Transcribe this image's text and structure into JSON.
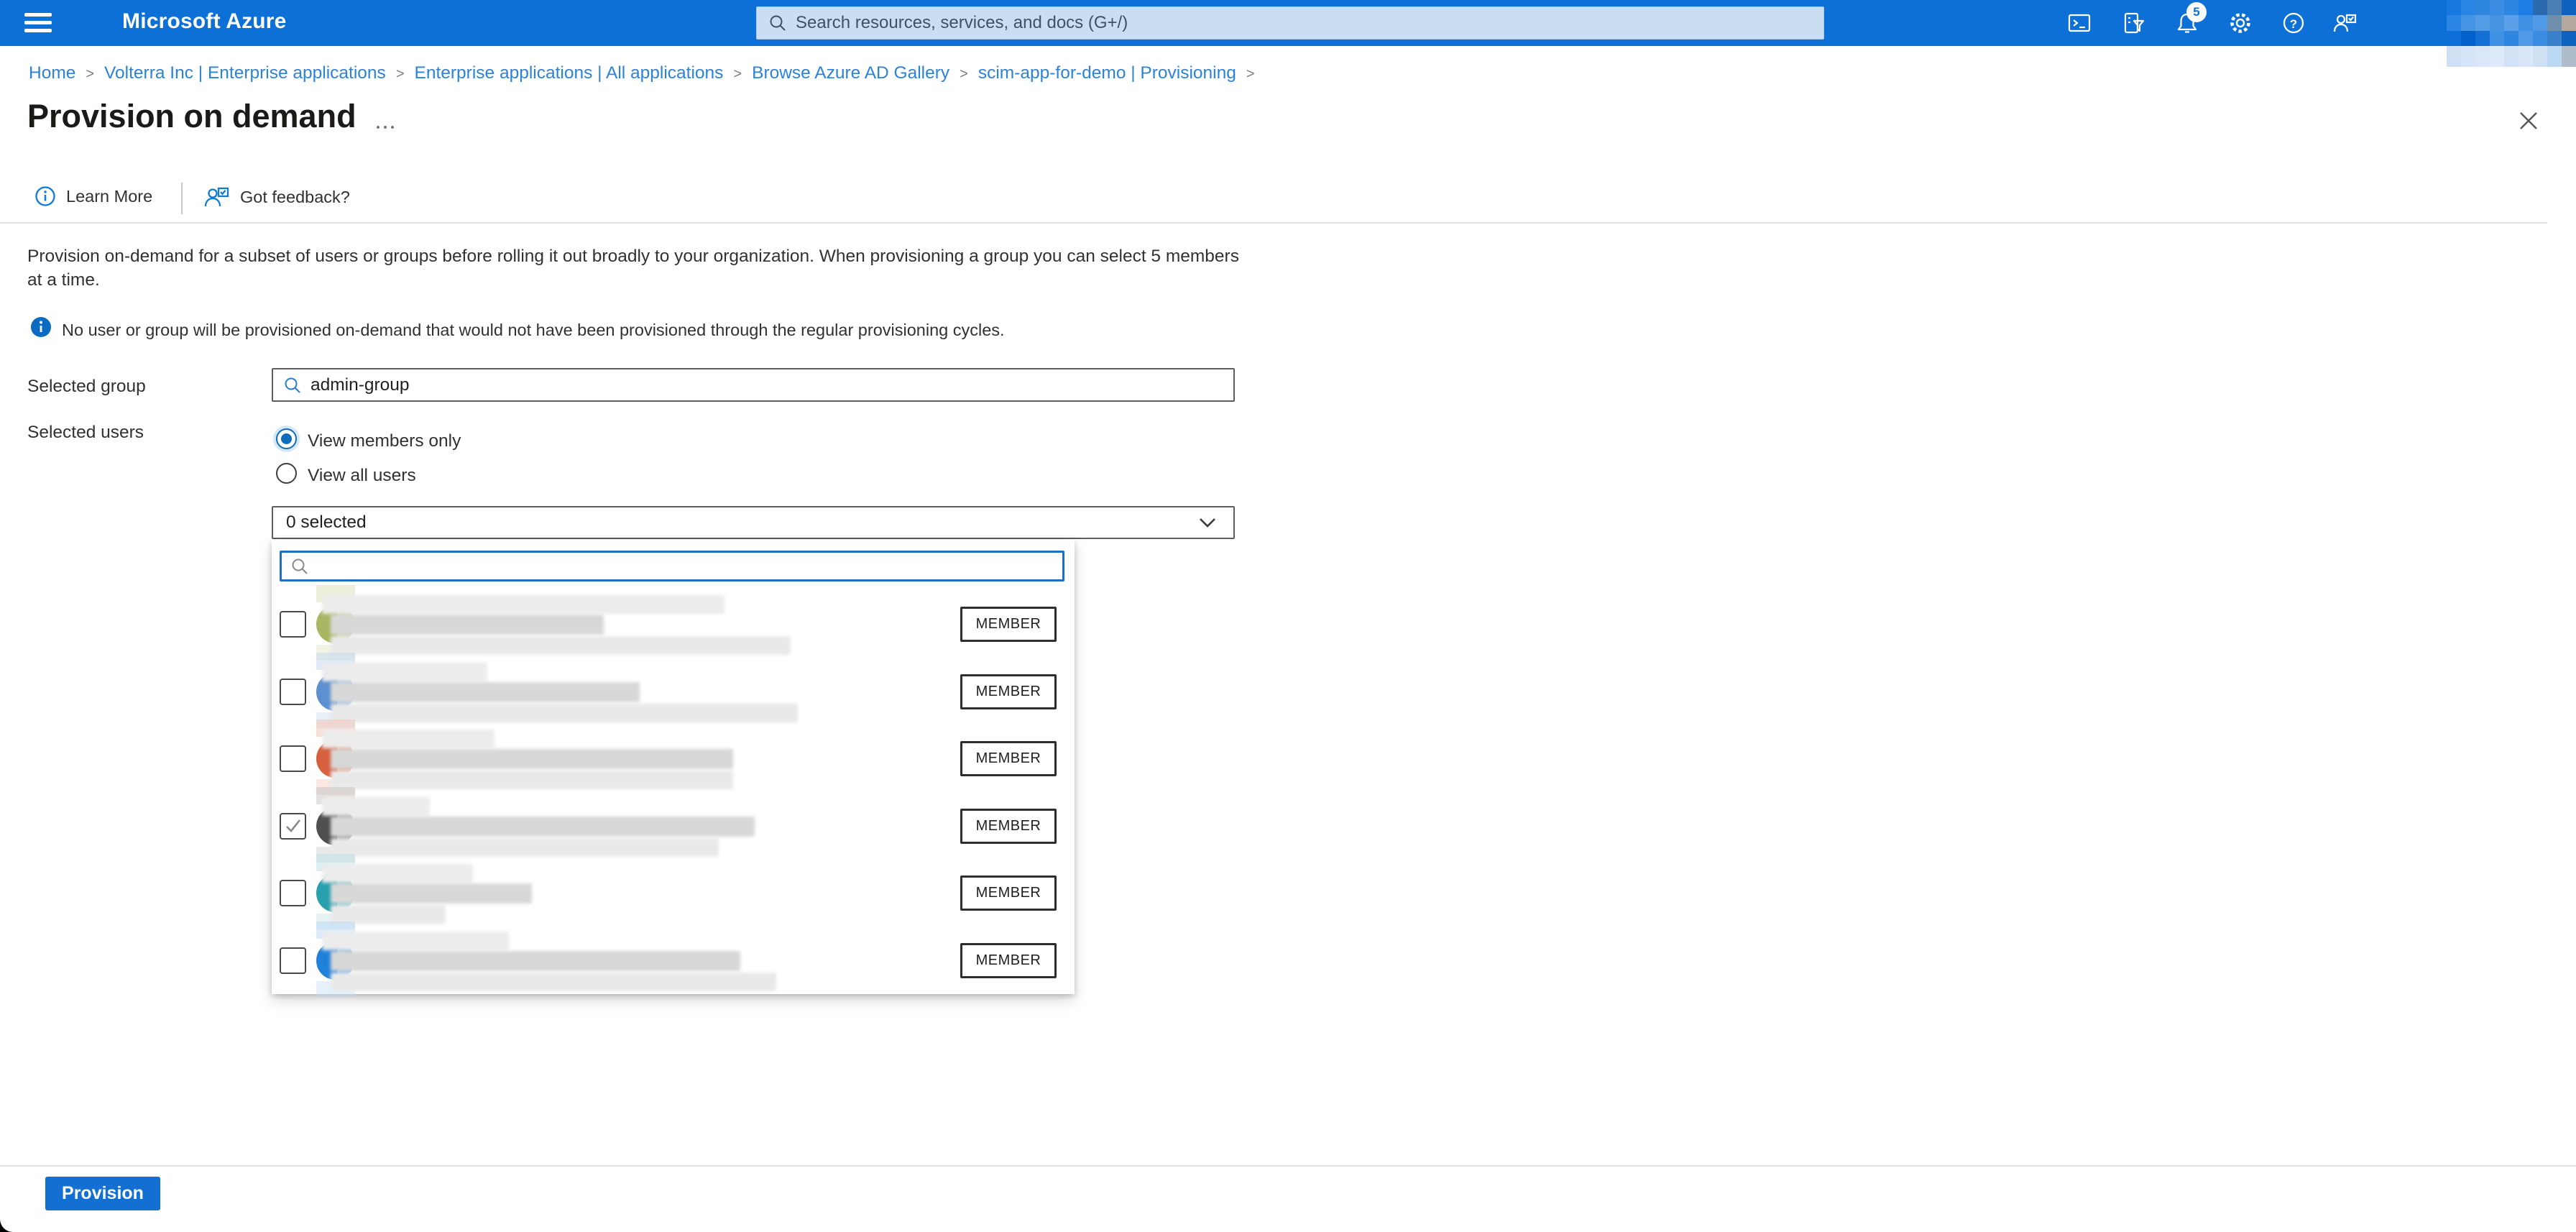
{
  "header": {
    "brand": "Microsoft Azure",
    "search_placeholder": "Search resources, services, and docs (G+/)",
    "notification_count": "5",
    "icons": [
      "cloud-shell-icon",
      "directory-filter-icon",
      "notifications-bell-icon",
      "settings-gear-icon",
      "help-icon",
      "feedback-icon"
    ],
    "account_mosaic_rows": [
      [
        "#1779e0",
        "#2b85e2",
        "#2f86de",
        "#3a8de2",
        "#2f86e0",
        "#1d7de2",
        "#2a6bb0",
        "#4a7fb5",
        "#0f63c0"
      ],
      [
        "#2b85e2",
        "#4694e4",
        "#549ce6",
        "#4694e2",
        "#5ba0e8",
        "#4091e4",
        "#4f99e6",
        "#6d8fab",
        "#b3a89e"
      ],
      [
        "#0f6fd8",
        "#0361ce",
        "#1470d6",
        "#4091e4",
        "#2f86e0",
        "#4f99e6",
        "#3a8de2",
        "#3a80ca",
        "#0f63c0"
      ]
    ],
    "account_substrip": [
      "#cfe0f3",
      "#d5e4f6",
      "#d9e7f8",
      "#dceafa",
      "#d2e2f4",
      "#d8e6f7",
      "#cfe0f3",
      "#bcd9f4",
      "#aebdc9"
    ]
  },
  "breadcrumb": {
    "separator": ">",
    "items": [
      {
        "label": "Home"
      },
      {
        "label": "Volterra Inc | Enterprise applications"
      },
      {
        "label": "Enterprise applications | All applications"
      },
      {
        "label": "Browse Azure AD Gallery"
      },
      {
        "label": "scim-app-for-demo | Provisioning"
      }
    ]
  },
  "page": {
    "title": "Provision on demand",
    "toolbar": {
      "learn_more": "Learn More",
      "got_feedback": "Got feedback?"
    },
    "description": "Provision on-demand for a subset of users or groups before rolling it out broadly to your organization. When provisioning a group you can select 5 members at a time.",
    "info_note": "No user or group will be provisioned on-demand that would not have been provisioned through the regular provisioning cycles.",
    "form": {
      "selected_group_label": "Selected group",
      "selected_group_value": "admin-group",
      "selected_users_label": "Selected users",
      "radio_members_only": "View members only",
      "radio_all_users": "View all users",
      "dropdown_value": "0 selected",
      "member_search_value": ""
    },
    "members": [
      {
        "badge": "MEMBER",
        "checked": false,
        "avatar": "#a9b764",
        "avatar_light": "#dde3bb",
        "blur": [
          560,
          380,
          640
        ],
        "redacted": true
      },
      {
        "badge": "MEMBER",
        "checked": false,
        "avatar": "#5b8fd0",
        "avatar_light": "#c3d8f0",
        "blur": [
          230,
          430,
          650
        ],
        "redacted": true
      },
      {
        "badge": "MEMBER",
        "checked": false,
        "avatar": "#d7603f",
        "avatar_light": "#f2c4b5",
        "blur": [
          240,
          560,
          560
        ],
        "redacted": true
      },
      {
        "badge": "MEMBER",
        "checked": true,
        "avatar": "#4f4f4f",
        "avatar_light": "#c9c9c9",
        "blur": [
          150,
          590,
          540
        ],
        "redacted": true
      },
      {
        "badge": "MEMBER",
        "checked": false,
        "avatar": "#2a9fae",
        "avatar_light": "#bfe2e6",
        "blur": [
          210,
          280,
          160
        ],
        "redacted": true
      },
      {
        "badge": "MEMBER",
        "checked": false,
        "avatar": "#2180d8",
        "avatar_light": "#bed9f4",
        "blur": [
          260,
          570,
          620
        ],
        "redacted": true
      }
    ],
    "provision_button": "Provision"
  },
  "colors": {
    "header_bg": "#0c70d6",
    "link_blue": "#2b83d9",
    "accent_blue": "#0f6cbd",
    "focus_border": "#1f6fc5",
    "button_bg": "#1370d2"
  }
}
